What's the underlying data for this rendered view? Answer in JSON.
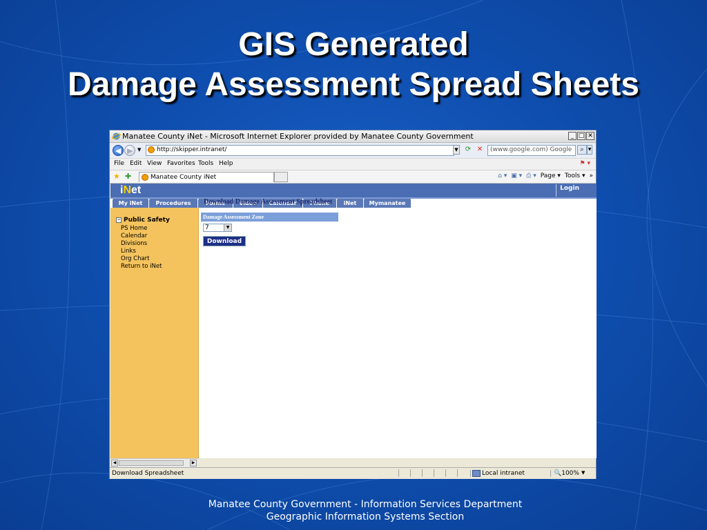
{
  "slide": {
    "title_line1": "GIS Generated",
    "title_line2": "Damage Assessment Spread Sheets",
    "footer_line1": "Manatee County Government - Information Services Department",
    "footer_line2": "Geographic Information Systems Section"
  },
  "browser": {
    "window_title": "Manatee County iNet - Microsoft Internet Explorer provided by Manatee County Government",
    "address": "http://skipper.intranet/",
    "search_placeholder": "(www.google.com) Google",
    "menu": [
      "File",
      "Edit",
      "View",
      "Favorites",
      "Tools",
      "Help"
    ],
    "tab_title": "Manatee County iNet",
    "commands": {
      "page": "Page",
      "tools": "Tools"
    },
    "status_text": "Download Spreadsheet",
    "zone": "Local intranet",
    "zoom": "100%"
  },
  "site": {
    "logo_i": "i",
    "logo_n": "N",
    "logo_et": "et",
    "login": "Login",
    "nav": [
      "My iNet",
      "Procedures",
      "Forms",
      "Video",
      "Calendar",
      "Phone",
      "iNet",
      "Mymanatee"
    ],
    "sidebar": {
      "section": "Public Safety",
      "links": [
        "PS Home",
        "Calendar",
        "Divisions",
        "Links",
        "Org Chart",
        "Return to iNet"
      ]
    },
    "main": {
      "heading": "Download Damage Assessment Spreadsheet",
      "zone_label": "Damage Assessment Zone",
      "zone_value": "7",
      "download_button": "Download"
    }
  },
  "colors": {
    "slide_bg": "#0f4fb0",
    "header_blue": "#4a6db3",
    "sidebar": "#f4c35d",
    "button": "#1d2f87"
  }
}
